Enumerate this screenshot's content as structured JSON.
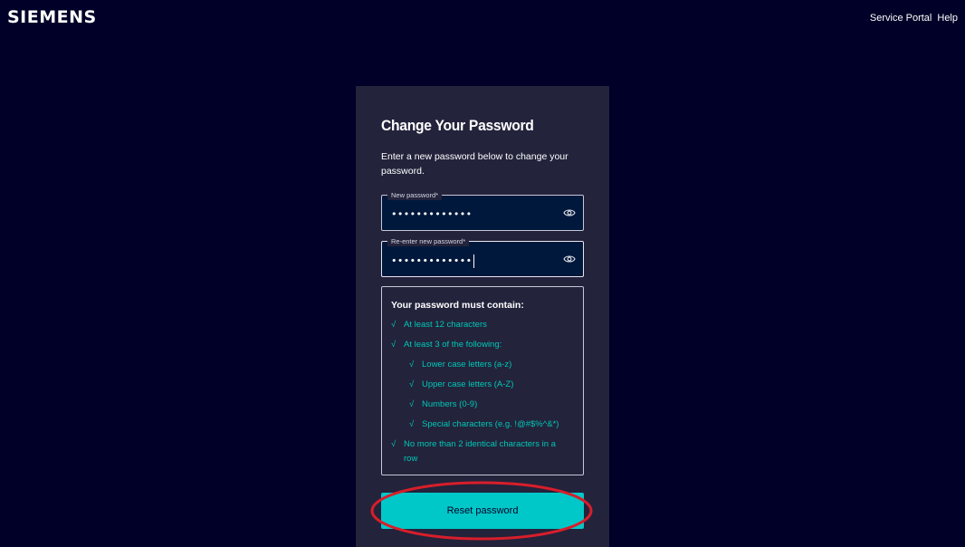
{
  "brand": {
    "logo_text": "SIEMENS"
  },
  "header": {
    "nav": [
      {
        "label": "Service Portal"
      },
      {
        "label": "Help"
      }
    ]
  },
  "form": {
    "title": "Change Your Password",
    "description": "Enter a new password below to change your password.",
    "new_password": {
      "label": "New password*",
      "masked_value": "•••••••••••••",
      "show_icon": "eye-icon"
    },
    "confirm_password": {
      "label": "Re-enter new password*",
      "masked_value": "•••••••••••••",
      "show_icon": "eye-icon"
    },
    "requirements": {
      "title": "Your password must contain:",
      "check_glyph": "√",
      "items": [
        {
          "text": "At least 12 characters",
          "met": true
        },
        {
          "text": "At least 3 of the following:",
          "met": true
        },
        {
          "text": "Lower case letters (a-z)",
          "met": true
        },
        {
          "text": "Upper case letters (A-Z)",
          "met": true
        },
        {
          "text": "Numbers (0-9)",
          "met": true
        },
        {
          "text": "Special characters (e.g. !@#$%^&*)",
          "met": true
        },
        {
          "text": "No more than 2 identical characters in a row",
          "met": true
        }
      ]
    },
    "submit_label": "Reset password"
  },
  "colors": {
    "background": "#000028",
    "card": "#23233c",
    "accent": "#00c8c8",
    "check": "#00c8b4",
    "annotation": "#d81e2a"
  }
}
